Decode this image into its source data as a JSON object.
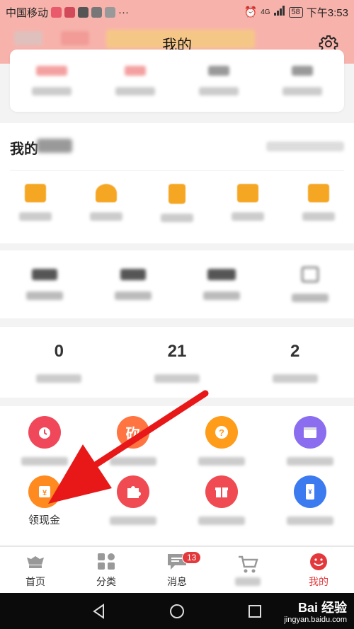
{
  "status_bar": {
    "carrier": "中国移动",
    "signal": "4G",
    "battery": "58",
    "time": "下午3:53"
  },
  "header": {
    "title": "我的"
  },
  "orders": {
    "title": "我的"
  },
  "counts": [
    {
      "value": "0"
    },
    {
      "value": "21"
    },
    {
      "value": "2"
    }
  ],
  "tools": [
    {
      "icon": "alarm-icon",
      "color": "#f0485a",
      "label": ""
    },
    {
      "icon": "bargain-icon",
      "color": "#ff7440",
      "label": ""
    },
    {
      "icon": "question-icon",
      "color": "#ff9c1a",
      "label": ""
    },
    {
      "icon": "calendar-icon",
      "color": "#8b6df0",
      "label": ""
    },
    {
      "icon": "cash-gift-icon",
      "color": "#ff8a1f",
      "label": "领现金"
    },
    {
      "icon": "puzzle-icon",
      "color": "#f04a52",
      "label": ""
    },
    {
      "icon": "gift-icon",
      "color": "#f04a52",
      "label": ""
    },
    {
      "icon": "phone-icon",
      "color": "#3c7af0",
      "label": ""
    }
  ],
  "tabbar": {
    "tabs": [
      {
        "label": "首页"
      },
      {
        "label": "分类"
      },
      {
        "label": "消息",
        "badge": "13"
      },
      {
        "label": ""
      },
      {
        "label": "我的"
      }
    ]
  },
  "watermark": {
    "brand": "Bai 经验",
    "url": "jingyan.baidu.com"
  },
  "colors": {
    "accent": "#e4393c",
    "header_bg": "#f7b3ab",
    "order_icon": "#f5a623",
    "arrow": "#e81818"
  }
}
